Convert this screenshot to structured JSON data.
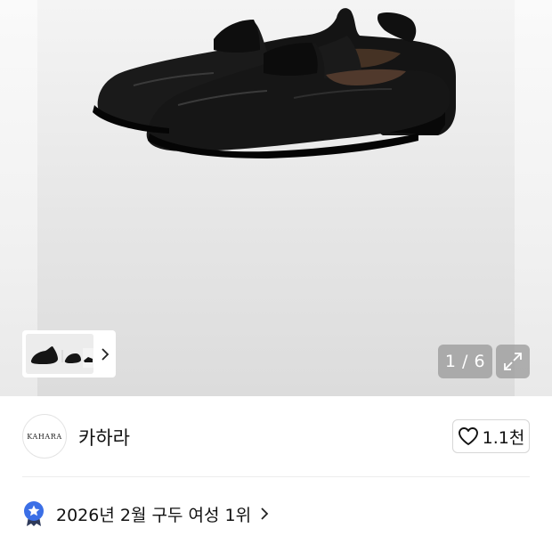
{
  "gallery": {
    "counter": "1 / 6",
    "expand_icon": "expand-arrows-icon",
    "thumb_next_icon": "chevron-right-icon"
  },
  "brand": {
    "logo_text": "KAHARA",
    "name": "카하라",
    "like_icon": "heart-outline-icon",
    "like_count": "1.1천"
  },
  "ranking": {
    "badge_icon": "star-ribbon-badge-icon",
    "text": "2026년 2월 구두 여성 1위",
    "chevron_icon": "chevron-right-icon"
  },
  "colors": {
    "accent_blue": "#3b6fe6",
    "text_primary": "#111111",
    "overlay_gray": "#969696"
  }
}
